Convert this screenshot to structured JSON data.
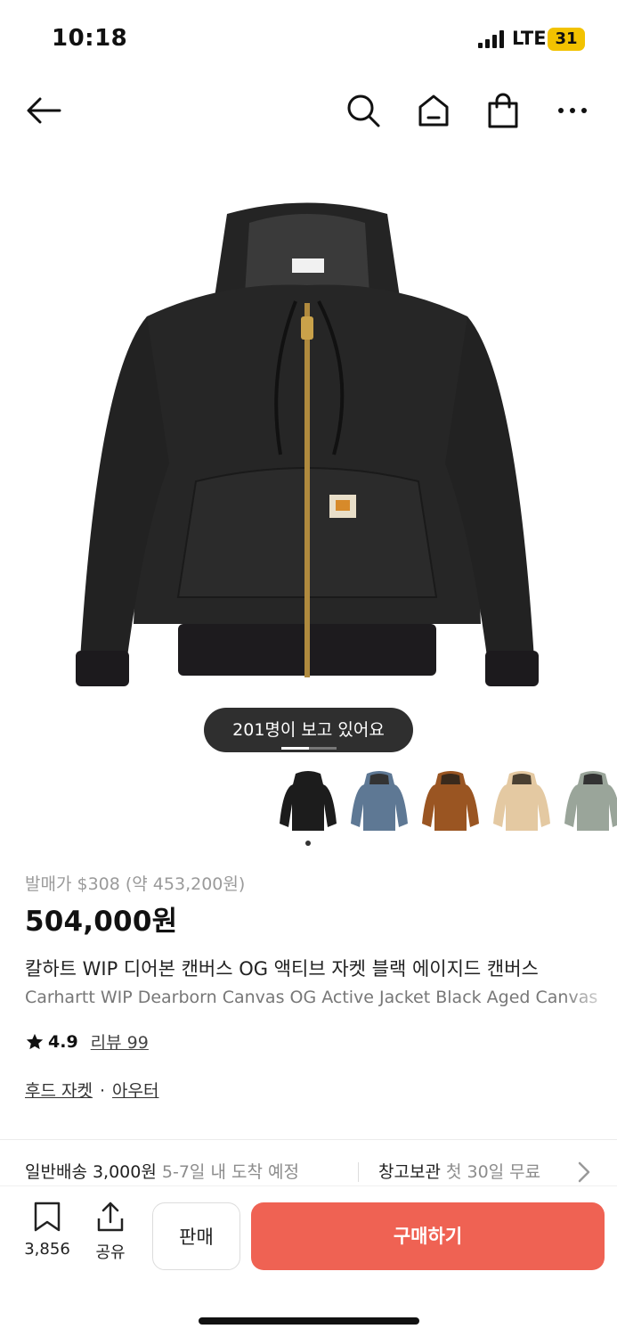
{
  "status_bar": {
    "time": "10:18",
    "network": "LTE",
    "battery": "31"
  },
  "nav": {
    "icons": [
      "back-arrow-icon",
      "search-icon",
      "home-icon",
      "shopping-bag-icon",
      "more-icon"
    ]
  },
  "hero": {
    "viewers_text": "201명이 보고 있어요",
    "image_index_progress": 0.5
  },
  "thumbnails": [
    {
      "name": "black",
      "color": "#1c1c1c"
    },
    {
      "name": "blue",
      "color": "#5e7894"
    },
    {
      "name": "brown",
      "color": "#9a5522"
    },
    {
      "name": "beige",
      "color": "#e4c9a2"
    },
    {
      "name": "sage",
      "color": "#9aa59a"
    }
  ],
  "product": {
    "release_price": "발매가 $308 (약 453,200원)",
    "price": "504,000원",
    "title_ko": "칼하트 WIP 디어본 캔버스 OG 액티브 자켓 블랙 에이지드 캔버스",
    "title_en": "Carhartt WIP Dearborn Canvas OG Active Jacket Black Aged Canvas",
    "rating": "4.9",
    "reviews_label": "리뷰 99",
    "category_1": "후드 자켓",
    "category_sep": "·",
    "category_2": "아우터"
  },
  "shipping": {
    "normal_label": "일반배송 3,000원",
    "normal_eta": "5-7일 내 도착 예정",
    "warehouse_label": "창고보관",
    "warehouse_note": "첫 30일 무료"
  },
  "bottom_bar": {
    "bookmark_count": "3,856",
    "share_label": "공유",
    "sell_label": "판매",
    "buy_label": "구매하기"
  },
  "colors": {
    "accent": "#ef6253",
    "badge": "#2f2f2f",
    "battery": "#f2c200"
  }
}
